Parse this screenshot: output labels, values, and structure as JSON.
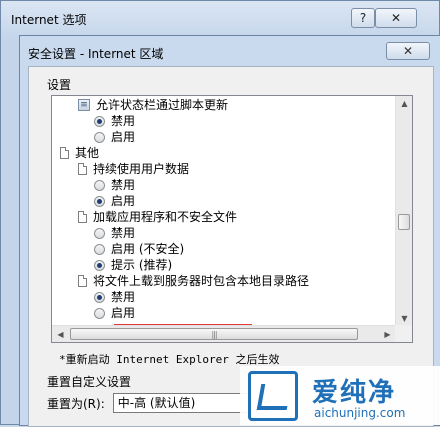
{
  "outer_window": {
    "title": "Internet 选项",
    "help_label": "?",
    "close_label": "✕"
  },
  "dialog": {
    "title": "安全设置 - Internet 区域",
    "close_label": "✕",
    "settings_label": "设置",
    "tree": [
      {
        "kind": "setting",
        "icon": "script-icon",
        "label": "允许状态栏通过脚本更新"
      },
      {
        "kind": "option",
        "label": "禁用",
        "selected": true
      },
      {
        "kind": "option",
        "label": "启用",
        "selected": false
      },
      {
        "kind": "category",
        "icon": "page-icon",
        "label": "其他"
      },
      {
        "kind": "setting",
        "icon": "page-icon",
        "label": "持续使用用户数据"
      },
      {
        "kind": "option",
        "label": "禁用",
        "selected": false
      },
      {
        "kind": "option",
        "label": "启用",
        "selected": true
      },
      {
        "kind": "setting",
        "icon": "page-icon",
        "label": "加载应用程序和不安全文件"
      },
      {
        "kind": "option",
        "label": "禁用",
        "selected": false
      },
      {
        "kind": "option",
        "label": "启用 (不安全)",
        "selected": false
      },
      {
        "kind": "option",
        "label": "提示 (推荐)",
        "selected": true
      },
      {
        "kind": "setting",
        "icon": "page-icon",
        "label": "将文件上载到服务器时包含本地目录路径"
      },
      {
        "kind": "option",
        "label": "禁用",
        "selected": true
      },
      {
        "kind": "option",
        "label": "启用",
        "selected": false
      }
    ],
    "restart_note": "*重新启动 Internet Explorer 之后生效",
    "reset_section_label": "重置自定义设置",
    "reset_to_label": "重置为(R):",
    "reset_to_value": "中-高 (默认值)"
  },
  "watermark": {
    "brand_cn": "爱纯净",
    "brand_en": "aichunjing.com"
  },
  "colors": {
    "highlight_border": "#e23a3a",
    "watermark_blue": "#1f70b8"
  }
}
